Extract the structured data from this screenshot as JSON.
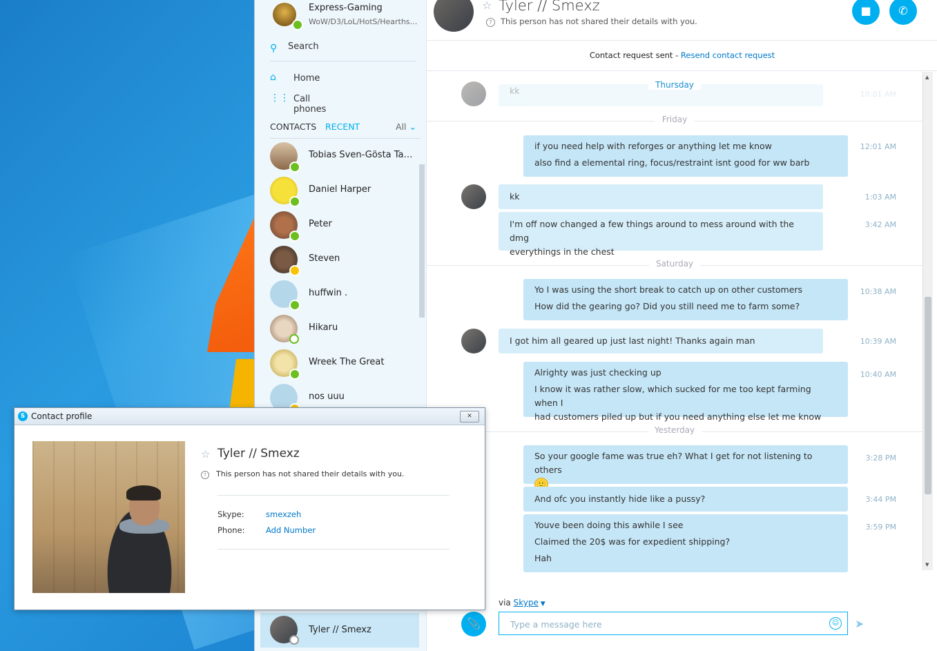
{
  "sidebar": {
    "group": {
      "name": "Express-Gaming",
      "subtitle": "WoW/D3/LoL/HotS/Hearthst..."
    },
    "search_label": "Search",
    "nav": [
      {
        "label": "Home",
        "icon": "home-icon"
      },
      {
        "label": "Call phones",
        "icon": "dialpad-icon"
      }
    ],
    "tabs": {
      "contacts": "CONTACTS",
      "recent": "RECENT",
      "filter": "All"
    },
    "contacts": [
      {
        "name": "Tobias Sven-Gösta Tae...",
        "status": "online"
      },
      {
        "name": "Daniel Harper",
        "status": "online"
      },
      {
        "name": "Peter",
        "status": "online"
      },
      {
        "name": "Steven",
        "status": "away"
      },
      {
        "name": "huffwin .",
        "status": "online"
      },
      {
        "name": "Hikaru",
        "status": "offline"
      },
      {
        "name": "Wreek The Great",
        "status": "online"
      },
      {
        "name": "nos uuu",
        "status": "away"
      }
    ],
    "selected_contact": {
      "name": "Tyler // Smexz",
      "status": "unknown"
    }
  },
  "conversation": {
    "name": "Tyler // Smexz",
    "subtitle": "This person has not shared their details with you.",
    "contact_request_text": "Contact request sent - ",
    "contact_request_link": "Resend contact request",
    "days": [
      "Thursday",
      "Friday",
      "Saturday",
      "Yesterday"
    ],
    "partial_message": {
      "text": "kk",
      "time": "10:01 AM"
    },
    "messages": [
      {
        "lines": [
          "if you need help with reforges or anything let me know",
          "also find a elemental ring, focus/restraint isnt good for ww barb"
        ],
        "time": "12:01 AM"
      },
      {
        "lines": [
          "kk"
        ],
        "time": "1:03 AM"
      },
      {
        "lines": [
          "I'm off now changed a few things around to mess around with the dmg",
          "everythings in the chest"
        ],
        "time": "3:42 AM"
      },
      {
        "lines": [
          "Yo I was using the short break to catch up on other customers",
          "How did the gearing go? Did you still need me to farm some?"
        ],
        "time": "10:38 AM"
      },
      {
        "lines": [
          "I got him all geared up just last night! Thanks again man"
        ],
        "time": "10:39 AM"
      },
      {
        "lines": [
          "Alrighty was just checking up",
          "I know it was rather slow, which sucked for me too kept farming when I",
          "had customers piled up but if you need anything else let me know"
        ],
        "time": "10:40 AM"
      },
      {
        "lines": [
          "So your google fame was true eh? What I get for not listening to others"
        ],
        "time": "3:28 PM",
        "emoji": "🙂"
      },
      {
        "lines": [
          "And ofc you instantly hide like a pussy?"
        ],
        "time": "3:44 PM"
      },
      {
        "lines": [
          "Youve been doing this awhile I see",
          "Claimed the 20$ was for expedient shipping?",
          "Hah"
        ],
        "time": "3:59 PM"
      }
    ],
    "via_label": "via",
    "via_link": "Skype",
    "input_placeholder": "Type a message here"
  },
  "dialog": {
    "title": "Contact profile",
    "close": "✕",
    "name": "Tyler // Smexz",
    "subtitle": "This person has not shared their details with you.",
    "fields": [
      {
        "label": "Skype:",
        "value": "smexzeh"
      },
      {
        "label": "Phone:",
        "value": "Add Number"
      }
    ]
  },
  "colors": {
    "accent": "#00aff0",
    "link": "#0078c8",
    "bubble": "#d6eef9",
    "online": "#6cbf1f",
    "away": "#f8c400"
  }
}
